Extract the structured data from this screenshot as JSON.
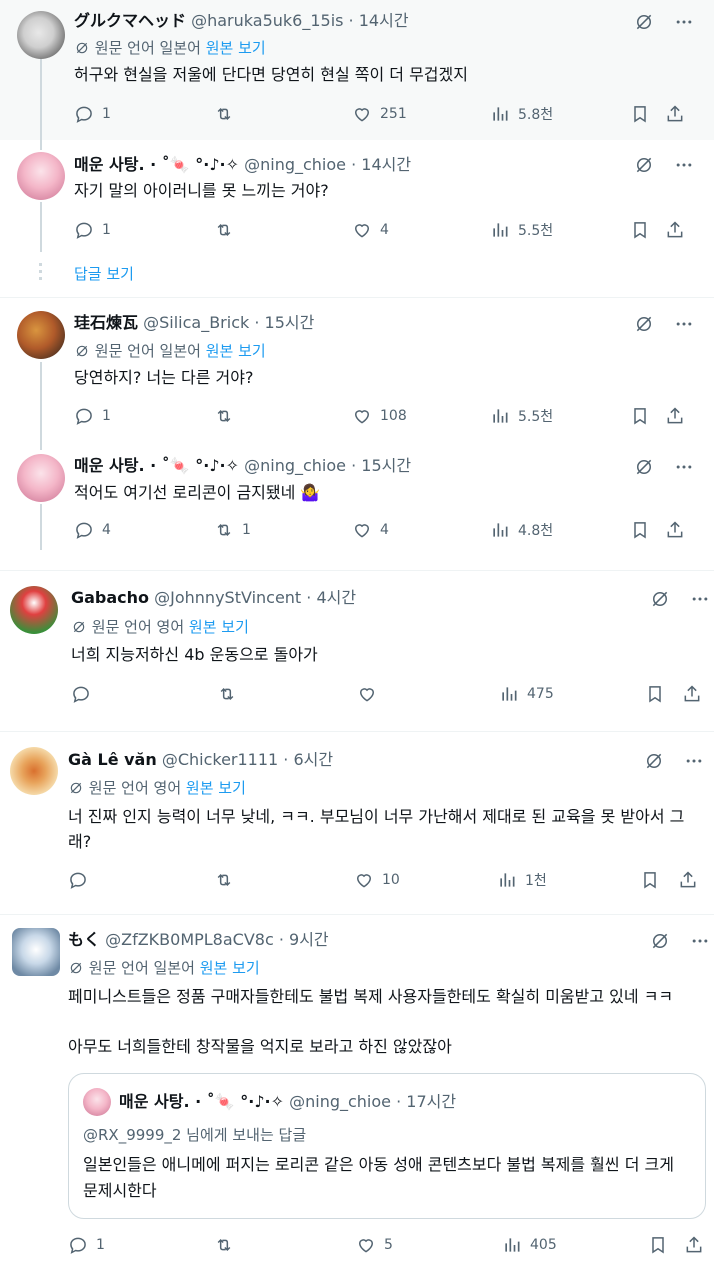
{
  "translate": {
    "label": "원문 언어 일본어",
    "label_en": "원문 언어 영어",
    "link": "원본 보기"
  },
  "tweets": [
    {
      "name": "グルクマヘッド",
      "handle": "@haruka5uk6_15is",
      "time": "14시간",
      "translated": true,
      "lang": "ja",
      "text": "허구와 현실을 저울에 단다면 당연히 현실 쪽이 더 무겁겠지",
      "replies": "1",
      "retweets": "",
      "likes": "251",
      "views": "5.8천"
    },
    {
      "name": "매운 사탕. · ˚🍬 °·♪·✧",
      "handle": "@ning_chioe",
      "time": "14시간",
      "translated": false,
      "text": "자기 말의 아이러니를 못 느끼는 거야?",
      "replies": "1",
      "retweets": "",
      "likes": "4",
      "views": "5.5천"
    },
    {
      "name": "珪石煉瓦",
      "handle": "@Silica_Brick",
      "time": "15시간",
      "translated": true,
      "lang": "ja",
      "text": "당연하지? 너는 다른 거야?",
      "replies": "1",
      "retweets": "",
      "likes": "108",
      "views": "5.5천"
    },
    {
      "name": "매운 사탕. · ˚🍬 °·♪·✧",
      "handle": "@ning_chioe",
      "time": "15시간",
      "translated": false,
      "text": "적어도 여기선 로리콘이 금지됐네 🤷‍♀️",
      "replies": "4",
      "retweets": "1",
      "likes": "4",
      "views": "4.8천"
    },
    {
      "name": "Gabacho",
      "handle": "@JohnnyStVincent",
      "time": "4시간",
      "translated": true,
      "lang": "en",
      "text": "너희 지능저하신 4b 운동으로 돌아가",
      "replies": "",
      "retweets": "",
      "likes": "",
      "views": "475"
    },
    {
      "name": "Gà Lê văn",
      "handle": "@Chicker1111",
      "time": "6시간",
      "translated": true,
      "lang": "en",
      "text": "너 진짜 인지 능력이 너무 낮네, ㅋㅋ. 부모님이 너무 가난해서 제대로 된 교육을 못 받아서 그래?",
      "replies": "",
      "retweets": "",
      "likes": "10",
      "views": "1천"
    },
    {
      "name": "もく",
      "handle": "@ZfZKB0MPL8aCV8c",
      "time": "9시간",
      "translated": true,
      "lang": "ja",
      "text": "페미니스트들은 정품 구매자들한테도 불법 복제 사용자들한테도 확실히 미움받고 있네 ㅋㅋ",
      "text2": "아무도 너희들한테 창작물을 억지로 보라고 하진 않았잖아",
      "replies": "1",
      "retweets": "",
      "likes": "5",
      "views": "405"
    }
  ],
  "show_replies": "답글 보기",
  "quote": {
    "name": "매운 사탕. · ˚🍬 °·♪·✧",
    "handle": "@ning_chioe",
    "time": "17시간",
    "reply_to": "@RX_9999_2 님에게 보내는 답글",
    "text": "일본인들은 애니메에 퍼지는 로리콘 같은 아동 성애 콘텐츠보다 불법 복제를 훨씬 더 크게 문제시한다"
  },
  "colors": {
    "link": "#1d9bf0",
    "muted": "#536471",
    "text": "#0f1419",
    "highlight_bg": "#f7f9f9"
  }
}
